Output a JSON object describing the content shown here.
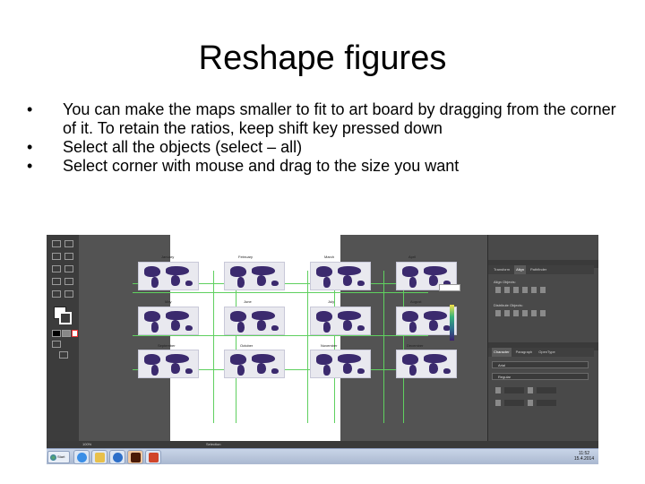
{
  "slide": {
    "title": "Reshape figures",
    "bullets": [
      "You can make the maps smaller to fit to art board by dragging from the corner of it. To retain the ratios, keep shift key pressed down",
      "Select all the objects (select – all)",
      "Select corner with mouse and drag to the size you want"
    ],
    "bullet_symbol": "•"
  },
  "screenshot": {
    "map_titles": [
      "January",
      "February",
      "March",
      "April",
      "May",
      "June",
      "July",
      "August",
      "September",
      "October",
      "November",
      "December"
    ],
    "panel": {
      "tabs_top": [
        "Transform",
        "Align",
        "Pathfinder"
      ],
      "align_objects": "Align Objects:",
      "distribute_objects": "Distribute Objects:",
      "tabs_char": [
        "Character",
        "Paragraph",
        "OpenType"
      ],
      "font_family": "Arial",
      "font_style": "Regular"
    },
    "status": {
      "zoom": "100%",
      "tool": "Selection"
    },
    "taskbar": {
      "start_label": "Start",
      "clock_time": "11:52",
      "clock_date": "15.4.2014"
    },
    "colors": {
      "ui_dark": "#535353",
      "map_land": "#3b2a6e",
      "guides": "#5fd05f",
      "taskbar": "#c9d5e8"
    }
  }
}
